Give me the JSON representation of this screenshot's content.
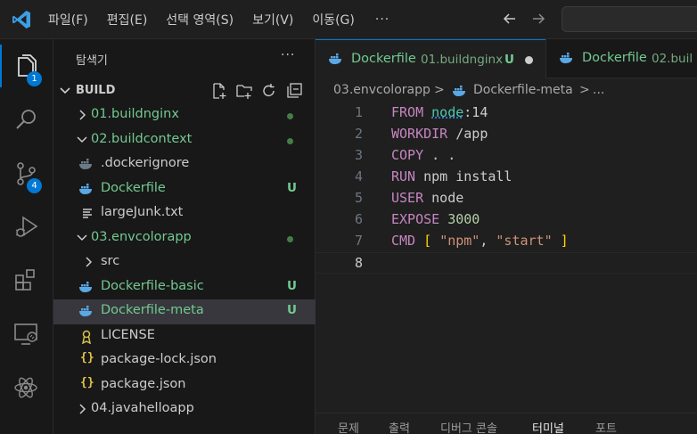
{
  "menu": {
    "items": [
      "파일(F)",
      "편집(E)",
      "선택 영역(S)",
      "보기(V)",
      "이동(G)"
    ],
    "more": "···"
  },
  "activity": {
    "explorer_badge": "1",
    "scm_badge": "4"
  },
  "sidebar": {
    "title": "탐색기",
    "more": "···",
    "section": "BUILD",
    "tree": [
      {
        "label": "01.buildnginx",
        "type": "folder",
        "expanded": false,
        "depth": 1,
        "status": "dot"
      },
      {
        "label": "02.buildcontext",
        "type": "folder",
        "expanded": true,
        "depth": 1,
        "status": "dot"
      },
      {
        "label": ".dockerignore",
        "type": "docker-dim",
        "depth": 2,
        "status": ""
      },
      {
        "label": "Dockerfile",
        "type": "docker",
        "depth": 2,
        "status": "U"
      },
      {
        "label": "largeJunk.txt",
        "type": "text",
        "depth": 2,
        "status": ""
      },
      {
        "label": "03.envcolorapp",
        "type": "folder",
        "expanded": true,
        "depth": 1,
        "status": "dot"
      },
      {
        "label": "src",
        "type": "folder",
        "expanded": false,
        "depth": 2,
        "status": ""
      },
      {
        "label": "Dockerfile-basic",
        "type": "docker",
        "depth": 2,
        "status": "U"
      },
      {
        "label": "Dockerfile-meta",
        "type": "docker",
        "depth": 2,
        "status": "U",
        "selected": true
      },
      {
        "label": "LICENSE",
        "type": "license",
        "depth": 2,
        "status": ""
      },
      {
        "label": "package-lock.json",
        "type": "json",
        "depth": 2,
        "status": ""
      },
      {
        "label": "package.json",
        "type": "json",
        "depth": 2,
        "status": ""
      },
      {
        "label": "04.javahelloapp",
        "type": "folder",
        "expanded": false,
        "depth": 1,
        "status": ""
      }
    ]
  },
  "tabs": [
    {
      "name": "Dockerfile",
      "desc": "01.buildnginx",
      "status": "U",
      "modified": true
    },
    {
      "name": "Dockerfile",
      "desc": "02.buil"
    }
  ],
  "breadcrumb": {
    "folder": "03.envcolorapp",
    "sep1": ">",
    "file": "Dockerfile-meta",
    "sep2": ">",
    "ellipsis": "..."
  },
  "code": {
    "line_numbers": [
      "1",
      "2",
      "3",
      "4",
      "5",
      "6",
      "7",
      "8"
    ],
    "lines": [
      [
        "FROM",
        "node",
        ":14"
      ],
      [
        "WORKDIR",
        "/app"
      ],
      [
        "COPY",
        ". ."
      ],
      [
        "RUN",
        "npm install"
      ],
      [
        "USER",
        "node"
      ],
      [
        "EXPOSE",
        "3000"
      ],
      [
        "CMD",
        "[",
        "\"npm\"",
        ",",
        "\"start\"",
        "]"
      ],
      []
    ]
  },
  "panel": {
    "tabs": [
      "문제",
      "출력",
      "디버그 콘솔",
      "터미널",
      "포트"
    ],
    "active": "터미널"
  },
  "colors": {
    "accent": "#0078d4",
    "untracked": "#73c991",
    "keyword": "#c586c0",
    "string": "#ce9178"
  }
}
